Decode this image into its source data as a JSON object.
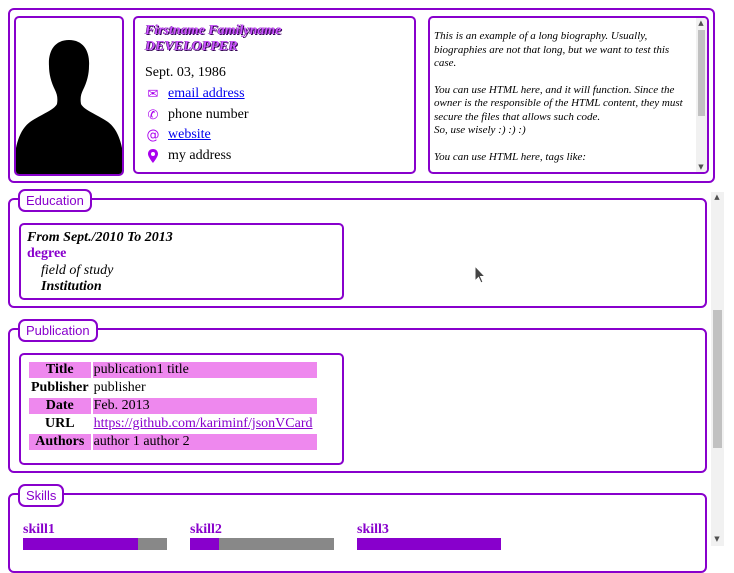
{
  "header": {
    "name": "Firstname Familyname",
    "role": "DEVELOPPER",
    "birthdate": "Sept. 03, 1986",
    "contacts": [
      {
        "icon": "envelope-icon",
        "text": "email address",
        "link": true
      },
      {
        "icon": "phone-icon",
        "text": "phone number",
        "link": false
      },
      {
        "icon": "at-icon",
        "text": "website",
        "link": true
      },
      {
        "icon": "location-pin-icon",
        "text": "my address",
        "link": false
      }
    ],
    "bio": {
      "p1": "This is an example of a long biography. Usually, biographies are not that long, but we want to test this case.",
      "p2a": "You can use HTML here, and it will function. Since the owner is the responsible of the HTML content, they must secure the files that allows such code.",
      "p2b": "So, use wisely :) :) :)",
      "p3": "You can use HTML here, tags like:"
    }
  },
  "education": {
    "legend": "Education",
    "entries": [
      {
        "period": "From Sept./2010 To 2013",
        "degree": "degree",
        "field": "field of study",
        "institution": "Institution"
      }
    ]
  },
  "publication": {
    "legend": "Publication",
    "rows": [
      {
        "label": "Title",
        "value": "publication1 title"
      },
      {
        "label": "Publisher",
        "value": "publisher"
      },
      {
        "label": "Date",
        "value": "Feb. 2013"
      },
      {
        "label": "URL",
        "value": "https://github.com/kariminf/jsonVCard"
      },
      {
        "label": "Authors",
        "value": "author 1 author 2"
      }
    ]
  },
  "skills": {
    "legend": "Skills",
    "items": [
      {
        "name": "skill1",
        "level": 0.8
      },
      {
        "name": "skill2",
        "level": 0.2
      },
      {
        "name": "skill3",
        "level": 1.0
      }
    ]
  },
  "colors": {
    "accent": "#8800cc",
    "row_highlight": "#ee88ee",
    "bar_bg": "#888888"
  }
}
